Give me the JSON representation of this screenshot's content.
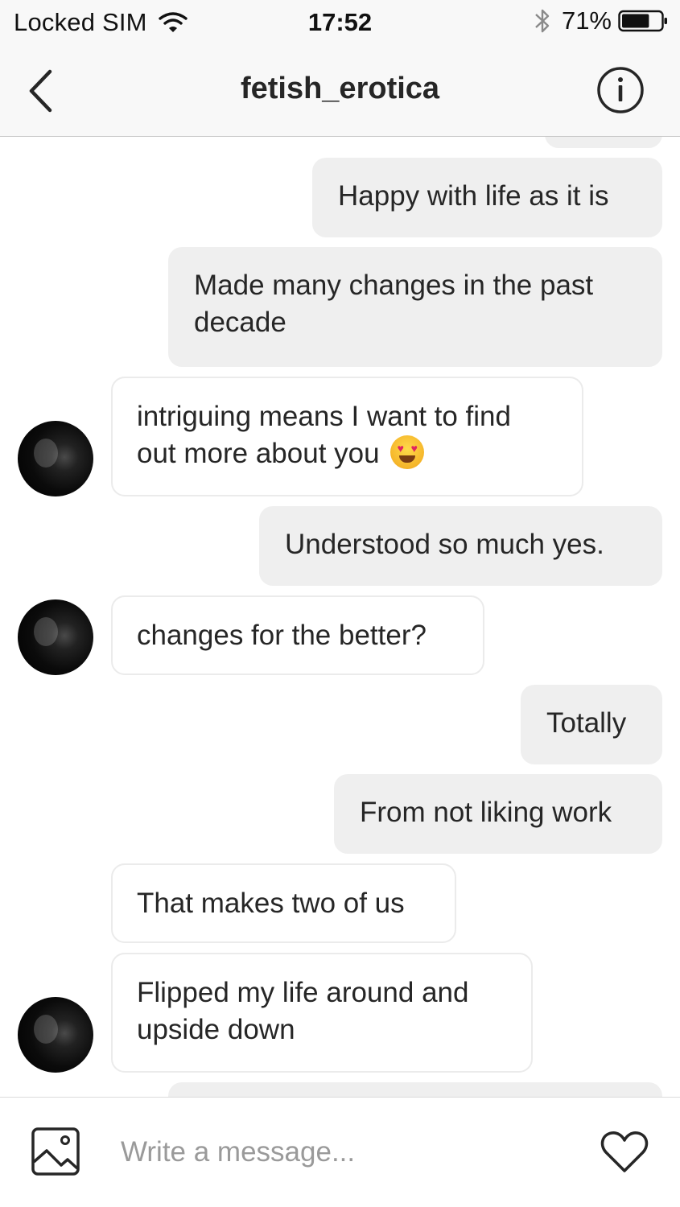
{
  "status_bar": {
    "carrier": "Locked SIM",
    "time": "17:52",
    "battery_percent": "71%",
    "battery_level": 0.71
  },
  "header": {
    "title": "fetish_erotica",
    "back_icon": "chevron-left-icon",
    "info_icon": "info-icon"
  },
  "messages": [
    {
      "direction": "outgoing",
      "text": "Happy with life as it is"
    },
    {
      "direction": "outgoing",
      "text": "Made many changes in the past decade"
    },
    {
      "direction": "incoming",
      "text": "intriguing means I want to find out more about you",
      "emoji": "heart-eyes-emoji"
    },
    {
      "direction": "outgoing",
      "text": "Understood so much yes."
    },
    {
      "direction": "incoming",
      "text": "changes for the better?"
    },
    {
      "direction": "outgoing",
      "text": "Totally"
    },
    {
      "direction": "outgoing",
      "text": "From not liking work"
    },
    {
      "direction": "incoming",
      "text": "That makes two of us"
    },
    {
      "direction": "incoming",
      "text": "Flipped my life around and upside down"
    }
  ],
  "composer": {
    "placeholder": "Write a message...",
    "value": "",
    "gallery_icon": "image-icon",
    "like_icon": "heart-icon"
  },
  "colors": {
    "outgoing_bubble": "#efefef",
    "incoming_border": "#ebebeb",
    "bar_background": "#f8f8f8",
    "text": "#262626",
    "placeholder": "#9a9a9a"
  }
}
